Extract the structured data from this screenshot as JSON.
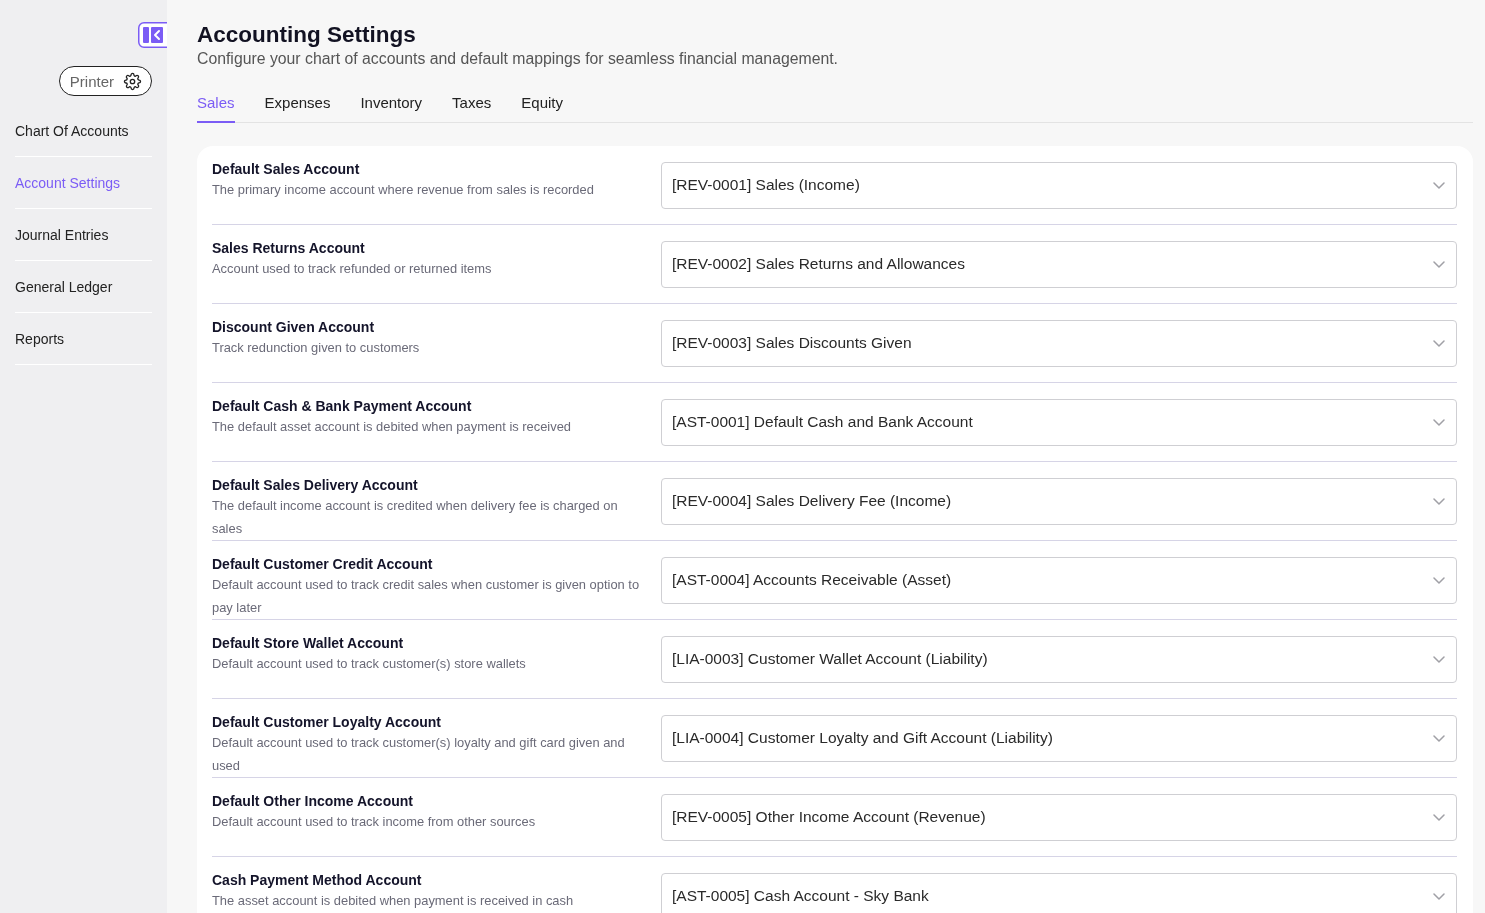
{
  "sidebar": {
    "printer_button": "Printer",
    "items": [
      {
        "label": "Chart Of Accounts",
        "selected": false
      },
      {
        "label": "Account Settings",
        "selected": true
      },
      {
        "label": "Journal Entries",
        "selected": false
      },
      {
        "label": "General Ledger",
        "selected": false
      },
      {
        "label": "Reports",
        "selected": false
      }
    ]
  },
  "header": {
    "title": "Accounting Settings",
    "subtitle": "Configure your chart of accounts and default mappings for seamless financial management."
  },
  "tabs": [
    {
      "label": "Sales",
      "selected": true
    },
    {
      "label": "Expenses",
      "selected": false
    },
    {
      "label": "Inventory",
      "selected": false
    },
    {
      "label": "Taxes",
      "selected": false
    },
    {
      "label": "Equity",
      "selected": false
    }
  ],
  "settings": [
    {
      "title": "Default Sales Account",
      "description": "The primary income account where revenue from sales is recorded",
      "value": "[REV-0001] Sales (Income)"
    },
    {
      "title": "Sales Returns Account",
      "description": "Account used to track refunded or returned items",
      "value": "[REV-0002] Sales Returns and Allowances"
    },
    {
      "title": "Discount Given Account",
      "description": "Track redunction given to customers",
      "value": "[REV-0003] Sales Discounts Given"
    },
    {
      "title": "Default Cash & Bank Payment Account",
      "description": "The default asset account is debited when payment is received",
      "value": "[AST-0001] Default Cash and Bank Account"
    },
    {
      "title": "Default Sales Delivery Account",
      "description": "The default income account is credited when delivery fee is charged on sales",
      "value": "[REV-0004] Sales Delivery Fee (Income)"
    },
    {
      "title": "Default Customer Credit Account",
      "description": "Default account used to track credit sales when customer is given option to pay later",
      "value": "[AST-0004] Accounts Receivable (Asset)"
    },
    {
      "title": "Default Store Wallet Account",
      "description": "Default account used to track customer(s) store wallets",
      "value": "[LIA-0003] Customer Wallet Account (Liability)"
    },
    {
      "title": "Default Customer Loyalty Account",
      "description": "Default account used to track customer(s) loyalty and gift card given and used",
      "value": "[LIA-0004] Customer Loyalty and Gift Account (Liability)"
    },
    {
      "title": "Default Other Income Account",
      "description": "Default account used to track income from other sources",
      "value": "[REV-0005] Other Income Account (Revenue)"
    },
    {
      "title": "Cash Payment Method Account",
      "description": "The asset account is debited when payment is received in cash",
      "value": "[AST-0005] Cash Account - Sky Bank"
    }
  ]
}
